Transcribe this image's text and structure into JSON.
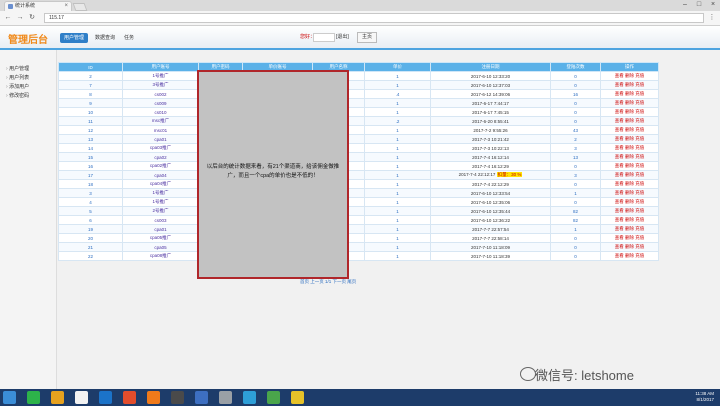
{
  "browser": {
    "tab_title": "统计系统",
    "url": "115.17",
    "tab_close": "×",
    "window_controls": [
      "–",
      "□",
      "×"
    ],
    "nav_icons": [
      "←",
      "→",
      "↻"
    ],
    "menu_icon": "⋮"
  },
  "header": {
    "brand": "管理后台",
    "tabs": [
      "用户管理",
      "数据查询",
      "任务"
    ],
    "info_label": "您好：",
    "info_text": "[退出]",
    "button": "主页"
  },
  "sidebar": {
    "items": [
      "用户管理",
      "用户列表",
      "添加用户",
      "修改密码"
    ]
  },
  "table": {
    "headers": [
      "ID",
      "用户账号",
      "用户密码",
      "单价账号",
      "用户名称",
      "单价",
      "注册日期",
      "登陆次数",
      "操作"
    ],
    "rows": [
      [
        "2",
        "1号推广",
        "",
        "",
        "",
        "1",
        "2017-6-10 12:33:20",
        "0",
        "查看 删除 充值"
      ],
      [
        "7",
        "3号推广",
        "",
        "",
        "",
        "1",
        "2017-6-10 12:37:03",
        "0",
        "查看 删除 充值"
      ],
      [
        "8",
        "cs002",
        "",
        "",
        "",
        ".4",
        "2017-6-12 14:39:06",
        "16",
        "查看 删除 充值"
      ],
      [
        "9",
        "cs009",
        "",
        "",
        "",
        "1",
        "2017-6-17 7:44:17",
        "0",
        "查看 删除 充值"
      ],
      [
        "10",
        "cs010",
        "",
        "",
        "",
        "1",
        "2017-6-17 7:45:15",
        "0",
        "查看 删除 充值"
      ],
      [
        "11",
        "msc推广",
        "",
        "",
        "",
        ".2",
        "2017-6-20 8:55:41",
        "0",
        "查看 删除 充值"
      ],
      [
        "12",
        "msc01",
        "",
        "",
        "",
        "1",
        "2017-7-2 9:55:26",
        "43",
        "查看 删除 充值"
      ],
      [
        "13",
        "cpa01",
        "",
        "",
        "",
        "1",
        "2017-7-3 10:21:42",
        "2",
        "查看 删除 充值"
      ],
      [
        "14",
        "cpa03推广",
        "",
        "",
        "",
        "1",
        "2017-7-3 10:22:13",
        "3",
        "查看 删除 充值"
      ],
      [
        "15",
        "cpa02",
        "",
        "",
        "",
        "1",
        "2017-7-4 16:12:14",
        "13",
        "查看 删除 充值"
      ],
      [
        "16",
        "cpa02推广",
        "",
        "",
        "",
        "1",
        "2017-7-4 16:12:29",
        "0",
        "查看 删除 充值"
      ],
      [
        "17",
        "cpa04",
        "",
        "",
        "",
        "1",
        "2017-7-4 22:12:17",
        "3",
        "查看 删除 充值"
      ],
      [
        "18",
        "cpa04推广",
        "",
        "",
        "",
        "1",
        "2017-7-4 22:12:29",
        "0",
        "查看 删除 充值"
      ],
      [
        "3",
        "1号推广",
        "",
        "",
        "",
        "1",
        "2017-6-10 12:33:54",
        "1",
        "查看 删除 充值"
      ],
      [
        "4",
        "1号推广",
        "",
        "",
        "",
        "1",
        "2017-6-10 12:35:06",
        "0",
        "查看 删除 充值"
      ],
      [
        "5",
        "2号推广",
        "",
        "",
        "",
        "1",
        "2017-6-10 12:35:44",
        "82",
        "查看 删除 充值"
      ],
      [
        "6",
        "cs003",
        "",
        "",
        "",
        "1",
        "2017-6-10 12:36:22",
        "82",
        "查看 删除 充值"
      ],
      [
        "19",
        "cpa01",
        "",
        "",
        "",
        "1",
        "2017-7-7 22:57:54",
        "1",
        "查看 删除 充值"
      ],
      [
        "20",
        "cpa05推广",
        "",
        "",
        "",
        "1",
        "2017-7-7 22:58:14",
        "0",
        "查看 删除 充值"
      ],
      [
        "21",
        "cpa05",
        "",
        "",
        "",
        "1",
        "2017-7-10 11:18:09",
        "0",
        "查看 删除 充值"
      ],
      [
        "22",
        "cpa08推广",
        "",
        "",
        "",
        "1",
        "2017-7-10 11:18:39",
        "0",
        "查看 删除 充值"
      ]
    ],
    "highlight_badge": "扣量：30 %"
  },
  "pager": "首页 上一页 1/1 下一页 尾页",
  "overlay_text": "以后台的统计数据来看，有21个渠道商，给该佣金做推广，而且一个cpa的单价也是不低的！",
  "taskbar": {
    "clock_time": "11:38 AM",
    "clock_date": "8/1/2017",
    "icon_colors": [
      "#3b8ed8",
      "#2db34a",
      "#e7a21f",
      "#f2f2f2",
      "#1b73c9",
      "#e24d2c",
      "#f07a1a",
      "#4a4a4a",
      "#3d6fc1",
      "#9aa0a6",
      "#2e9fd8",
      "#4aa54b",
      "#e6c229"
    ]
  },
  "watermark": "微信号: letshome",
  "colors": {
    "accent": "#5bb1e8",
    "brand": "#f08a1c",
    "overlay_border": "#b0262a"
  }
}
